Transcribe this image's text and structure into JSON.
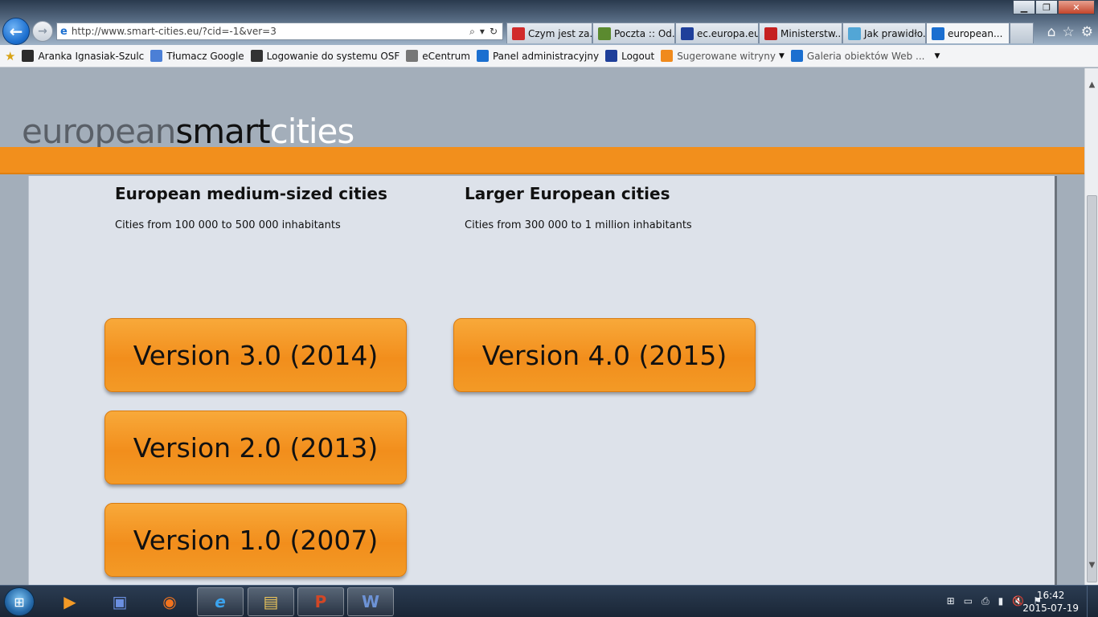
{
  "window": {
    "minimize": "▁",
    "maximize": "❐",
    "close": "✕"
  },
  "address": {
    "url": "http://www.smart-cities.eu/?cid=-1&ver=3",
    "search_glyph": "⌕",
    "dropdown_glyph": "▾",
    "refresh_glyph": "↻"
  },
  "tabs": [
    {
      "label": "Czym jest za...",
      "icon_color": "#d12b2b"
    },
    {
      "label": "Poczta :: Od...",
      "icon_color": "#5b8a2f"
    },
    {
      "label": "ec.europa.eu",
      "icon_color": "#1f3f9a"
    },
    {
      "label": "Ministerstw...",
      "icon_color": "#c52020"
    },
    {
      "label": "Jak prawidło...",
      "icon_color": "#52a6d6"
    },
    {
      "label": "european...",
      "icon_color": "#1b6fd0",
      "close": "✕"
    }
  ],
  "browser_tools": {
    "home": "⌂",
    "favorites": "☆",
    "settings": "⚙"
  },
  "favorites_bar": {
    "items": [
      {
        "label": "Aranka Ignasiak-Szulc",
        "icon_color": "#2b2b2b"
      },
      {
        "label": "Tłumacz Google",
        "icon_color": "#4b7fd6"
      },
      {
        "label": "Logowanie do systemu OSF",
        "icon_color": "#333333"
      },
      {
        "label": "eCentrum",
        "icon_color": "#777777"
      },
      {
        "label": "Panel administracyjny",
        "icon_color": "#1b6fd0"
      },
      {
        "label": "Logout",
        "icon_color": "#1f3f9a"
      },
      {
        "label": "Sugerowane witryny",
        "icon_color": "#f08a1c",
        "caret": "▼"
      },
      {
        "label": "Galeria obiektów Web ...",
        "icon_color": "#1b6fd0",
        "caret": "▼"
      }
    ]
  },
  "site": {
    "logo_part1": "european",
    "logo_part2": "smart",
    "logo_part3": "cities",
    "columns": [
      {
        "heading": "European medium-sized cities",
        "subtitle": "Cities from 100 000 to 500 000 inhabitants",
        "versions": [
          "Version 3.0 (2014)",
          "Version 2.0 (2013)",
          "Version 1.0 (2007)"
        ]
      },
      {
        "heading": "Larger European cities",
        "subtitle": "Cities from 300 000 to 1 million inhabitants",
        "versions": [
          "Version 4.0 (2015)"
        ]
      }
    ]
  },
  "scrollbar": {
    "up": "▲",
    "down": "▼"
  },
  "taskbar": {
    "start_glyph": "⊞",
    "apps": [
      {
        "name": "media-player",
        "glyph": "▶",
        "color": "#f39a26"
      },
      {
        "name": "save-app",
        "glyph": "▣",
        "color": "#2a54b8"
      },
      {
        "name": "firefox",
        "glyph": "◉",
        "color": "#f0731f"
      },
      {
        "name": "internet-explorer",
        "glyph": "e",
        "color": "#3ba3ee"
      },
      {
        "name": "file-explorer",
        "glyph": "▤",
        "color": "#e8c25b"
      },
      {
        "name": "powerpoint",
        "glyph": "P",
        "color": "#d24726"
      },
      {
        "name": "word",
        "glyph": "W",
        "color": "#2b5797"
      }
    ],
    "tray": [
      "⊞",
      "▭",
      "⎙",
      "▮",
      "🔇",
      "⚑"
    ],
    "time": "16:42",
    "date": "2015-07-19"
  }
}
